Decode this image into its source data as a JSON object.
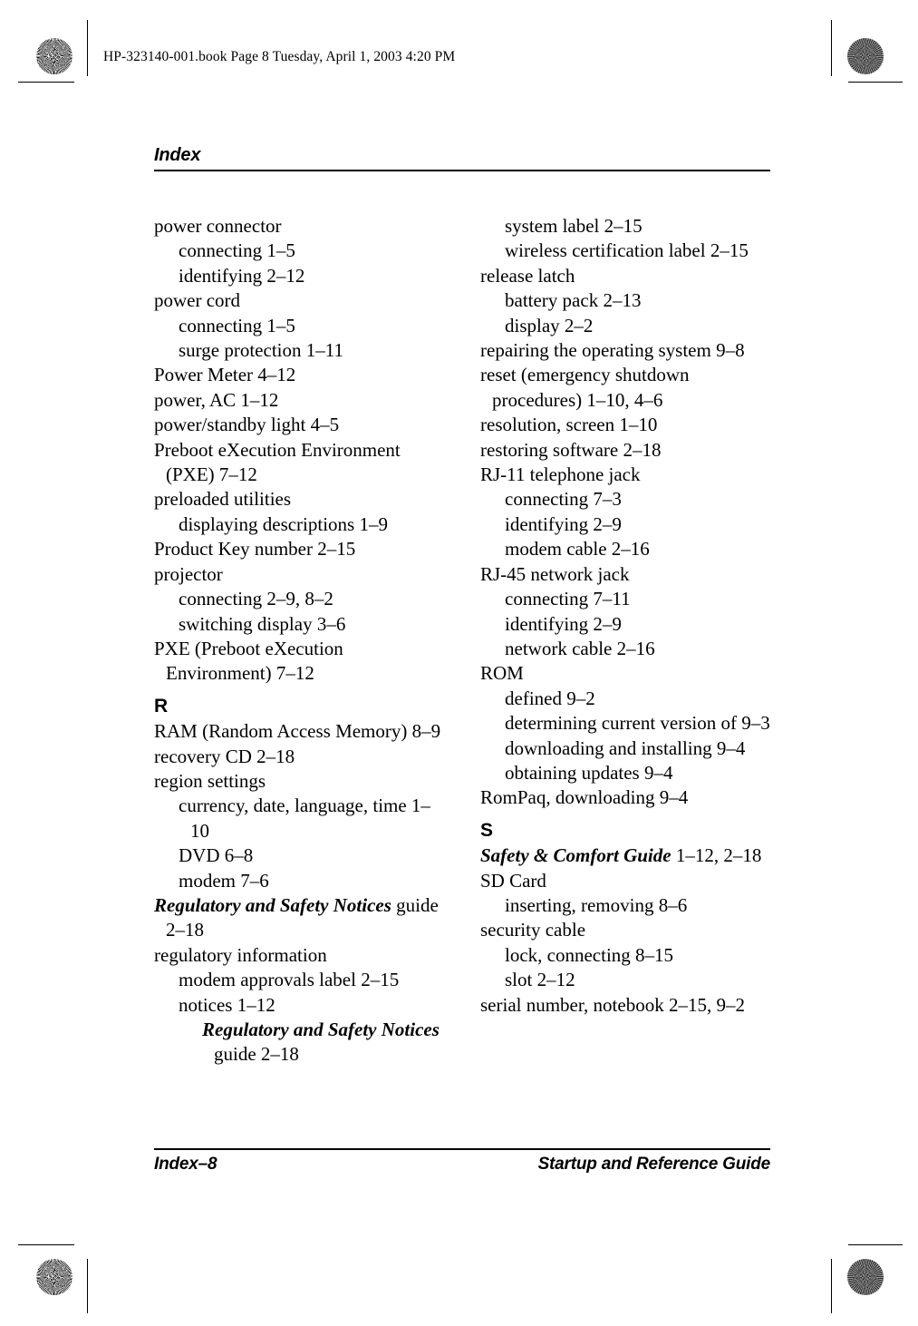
{
  "book_slug": "HP-323140-001.book  Page 8  Tuesday, April 1, 2003  4:20 PM",
  "header": {
    "title": "Index"
  },
  "footer": {
    "page_label": "Index–8",
    "guide_title": "Startup and Reference Guide"
  },
  "columns": {
    "left": [
      {
        "level": 0,
        "text": "power connector"
      },
      {
        "level": 1,
        "text": "connecting 1–5"
      },
      {
        "level": 1,
        "text": "identifying 2–12"
      },
      {
        "level": 0,
        "text": "power cord"
      },
      {
        "level": 1,
        "text": "connecting 1–5"
      },
      {
        "level": 1,
        "text": "surge protection 1–11"
      },
      {
        "level": 0,
        "text": "Power Meter 4–12"
      },
      {
        "level": 0,
        "text": "power, AC 1–12"
      },
      {
        "level": 0,
        "text": "power/standby light 4–5"
      },
      {
        "level": 0,
        "text": "Preboot eXecution Environment (PXE) 7–12"
      },
      {
        "level": 0,
        "text": "preloaded utilities"
      },
      {
        "level": 1,
        "text": "displaying descriptions 1–9"
      },
      {
        "level": 0,
        "text": "Product Key number 2–15"
      },
      {
        "level": 0,
        "text": "projector"
      },
      {
        "level": 1,
        "text": "connecting 2–9, 8–2"
      },
      {
        "level": 1,
        "text": "switching display 3–6"
      },
      {
        "level": 0,
        "text": "PXE (Preboot eXecution Environment) 7–12"
      },
      {
        "level": "letter",
        "text": "R"
      },
      {
        "level": 0,
        "text": "RAM (Random Access Memory) 8–9"
      },
      {
        "level": 0,
        "text": "recovery CD 2–18"
      },
      {
        "level": 0,
        "text": "region settings"
      },
      {
        "level": 1,
        "text": "currency, date, language, time 1–10"
      },
      {
        "level": 1,
        "text": "DVD 6–8"
      },
      {
        "level": 1,
        "text": "modem 7–6"
      },
      {
        "level": 0,
        "italic": "Regulatory and Safety Notices",
        "text": " guide 2–18"
      },
      {
        "level": 0,
        "text": "regulatory information"
      },
      {
        "level": 1,
        "text": "modem approvals label 2–15"
      },
      {
        "level": 1,
        "text": "notices 1–12"
      },
      {
        "level": 2,
        "italic": "Regulatory and Safety Notices",
        "text": " guide 2–18"
      }
    ],
    "right": [
      {
        "level": 1,
        "text": "system label 2–15"
      },
      {
        "level": 1,
        "text": "wireless certification label 2–15"
      },
      {
        "level": 0,
        "text": "release latch"
      },
      {
        "level": 1,
        "text": "battery pack 2–13"
      },
      {
        "level": 1,
        "text": "display 2–2"
      },
      {
        "level": 0,
        "text": "repairing the operating system 9–8"
      },
      {
        "level": 0,
        "text": "reset (emergency shutdown procedures) 1–10, 4–6"
      },
      {
        "level": 0,
        "text": "resolution, screen 1–10"
      },
      {
        "level": 0,
        "text": "restoring software 2–18"
      },
      {
        "level": 0,
        "text": "RJ-11 telephone jack"
      },
      {
        "level": 1,
        "text": "connecting 7–3"
      },
      {
        "level": 1,
        "text": "identifying 2–9"
      },
      {
        "level": 1,
        "text": "modem cable 2–16"
      },
      {
        "level": 0,
        "text": "RJ-45 network jack"
      },
      {
        "level": 1,
        "text": "connecting 7–11"
      },
      {
        "level": 1,
        "text": "identifying 2–9"
      },
      {
        "level": 1,
        "text": "network cable 2–16"
      },
      {
        "level": 0,
        "text": "ROM"
      },
      {
        "level": 1,
        "text": "defined 9–2"
      },
      {
        "level": 1,
        "text": "determining current version of 9–3"
      },
      {
        "level": 1,
        "text": "downloading and installing 9–4"
      },
      {
        "level": 1,
        "text": "obtaining updates 9–4"
      },
      {
        "level": 0,
        "text": "RomPaq, downloading 9–4"
      },
      {
        "level": "letter",
        "text": "S"
      },
      {
        "level": 0,
        "italic": "Safety & Comfort Guide",
        "text": " 1–12, 2–18"
      },
      {
        "level": 0,
        "text": "SD Card"
      },
      {
        "level": 1,
        "text": "inserting, removing 8–6"
      },
      {
        "level": 0,
        "text": "security cable"
      },
      {
        "level": 1,
        "text": "lock, connecting 8–15"
      },
      {
        "level": 1,
        "text": "slot 2–12"
      },
      {
        "level": 0,
        "text": "serial number, notebook 2–15, 9–2"
      }
    ]
  },
  "registration_marks": {
    "count": 12,
    "types": [
      "crosshair-target",
      "radial-starburst-target"
    ]
  }
}
